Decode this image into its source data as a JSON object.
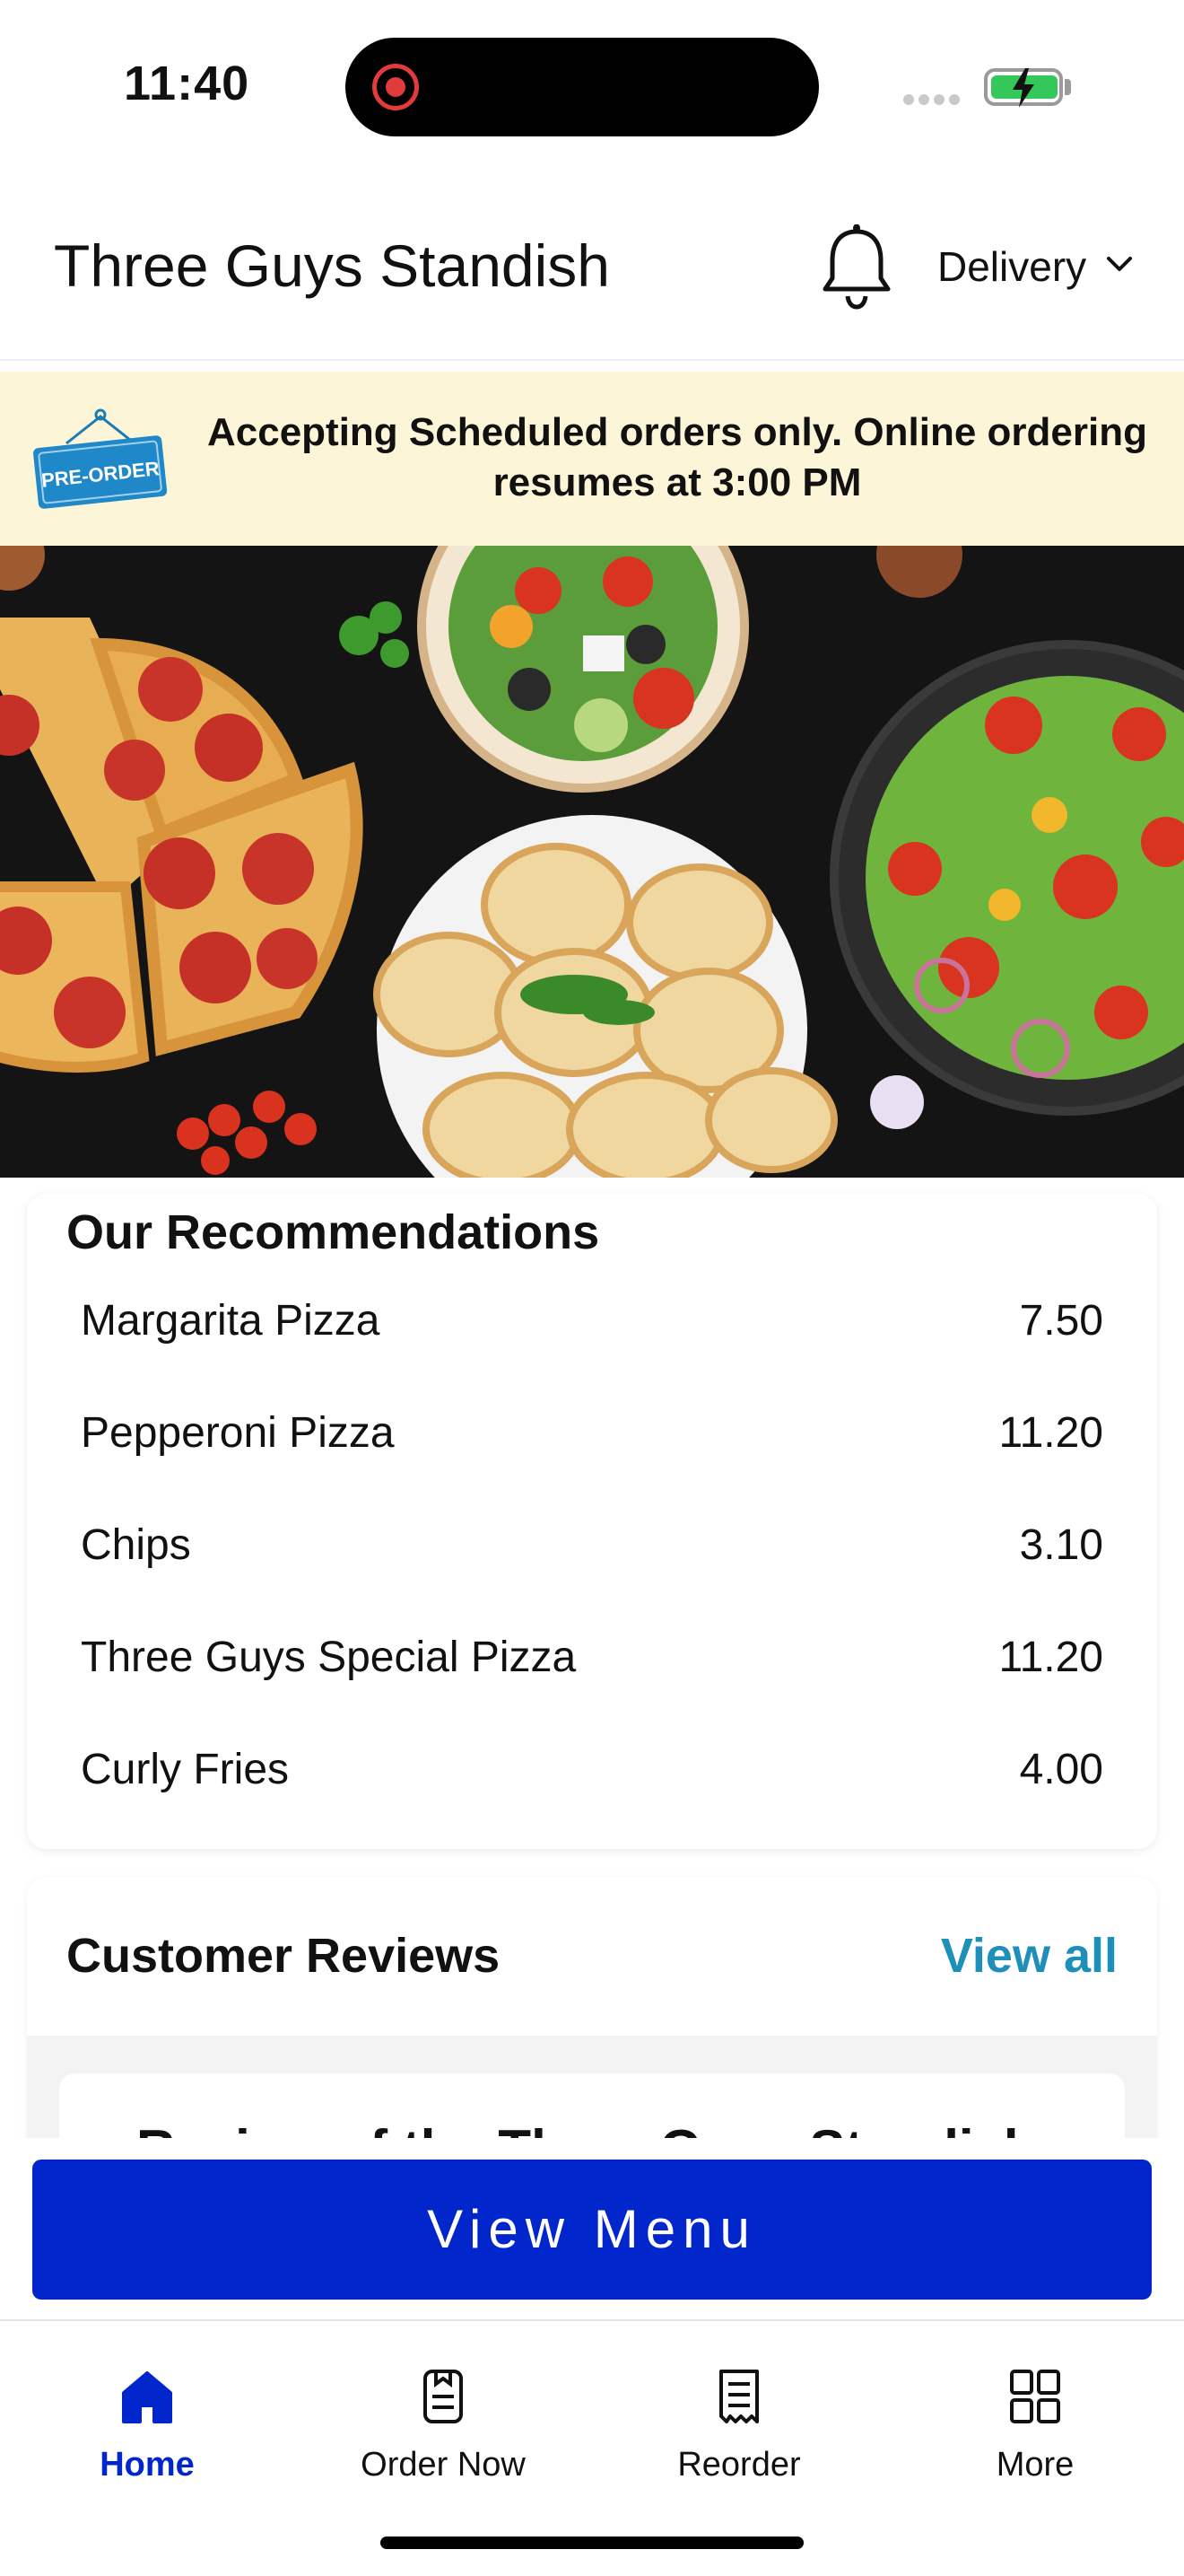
{
  "status_bar": {
    "time": "11:40"
  },
  "header": {
    "store_name": "Three Guys Standish",
    "delivery_mode": "Delivery"
  },
  "banner": {
    "badge": "PRE-ORDER",
    "message": "Accepting Scheduled orders only. Online ordering resumes at 3:00 PM"
  },
  "recommendations": {
    "title": "Our Recommendations",
    "items": [
      {
        "name": "Margarita Pizza",
        "price": "7.50"
      },
      {
        "name": "Pepperoni Pizza",
        "price": "11.20"
      },
      {
        "name": "Chips",
        "price": "3.10"
      },
      {
        "name": "Three Guys Special Pizza",
        "price": "11.20"
      },
      {
        "name": "Curly Fries",
        "price": "4.00"
      }
    ]
  },
  "reviews": {
    "title": "Customer Reviews",
    "view_all": "View all",
    "peek_text": "Review of the Three Guys Standish"
  },
  "view_menu_label": "View Menu",
  "nav": {
    "items": [
      {
        "label": "Home",
        "icon": "home-icon"
      },
      {
        "label": "Order Now",
        "icon": "order-icon"
      },
      {
        "label": "Reorder",
        "icon": "receipt-icon"
      },
      {
        "label": "More",
        "icon": "grid-icon"
      }
    ]
  },
  "colors": {
    "accent": "#0026cc",
    "link": "#1e8fb9",
    "banner_bg": "#fdf5d8",
    "battery": "#34c759"
  }
}
